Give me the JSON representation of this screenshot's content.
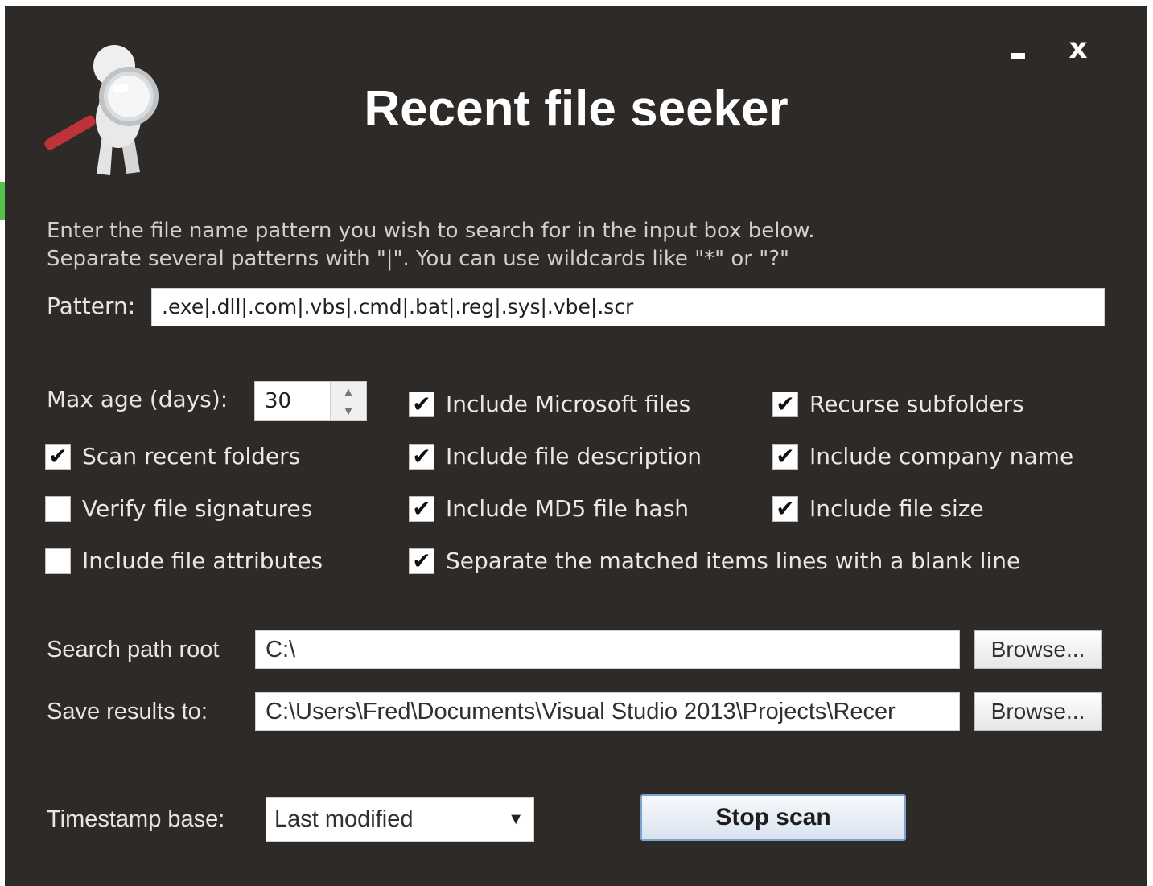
{
  "window": {
    "title": "Recent file seeker",
    "minimize_label": "-",
    "close_label": "x"
  },
  "instructions": {
    "line1": "Enter the file name pattern you wish to search for in the input box below.",
    "line2": "Separate several patterns with \"|\". You can use wildcards like \"*\" or \"?\""
  },
  "pattern": {
    "label": "Pattern:",
    "value": ".exe|.dll|.com|.vbs|.cmd|.bat|.reg|.sys|.vbe|.scr"
  },
  "max_age": {
    "label": "Max age (days):",
    "value": "30"
  },
  "options": [
    {
      "label": "Include Microsoft files",
      "checked": true
    },
    {
      "label": "Recurse subfolders",
      "checked": true
    },
    {
      "label": "Scan recent folders",
      "checked": true
    },
    {
      "label": "Include file description",
      "checked": true
    },
    {
      "label": "Include company name",
      "checked": true
    },
    {
      "label": "Verify file signatures",
      "checked": false
    },
    {
      "label": "Include MD5 file hash",
      "checked": true
    },
    {
      "label": "Include file size",
      "checked": true
    },
    {
      "label": "Include file attributes",
      "checked": false
    },
    {
      "label": "Separate the matched items lines with a blank line",
      "checked": true
    }
  ],
  "search_path": {
    "label": "Search path root",
    "value": "C:\\",
    "browse_label": "Browse..."
  },
  "save_results": {
    "label": "Save results to:",
    "value": "C:\\Users\\Fred\\Documents\\Visual Studio 2013\\Projects\\Recer",
    "browse_label": "Browse..."
  },
  "timestamp": {
    "label": "Timestamp base:",
    "selected": "Last modified"
  },
  "stop_button": {
    "label": "Stop scan"
  },
  "icons": {
    "logo": "magnifier-figure-icon",
    "minimize": "minimize-icon",
    "close": "close-icon",
    "dropdown": "chevron-down-icon"
  }
}
